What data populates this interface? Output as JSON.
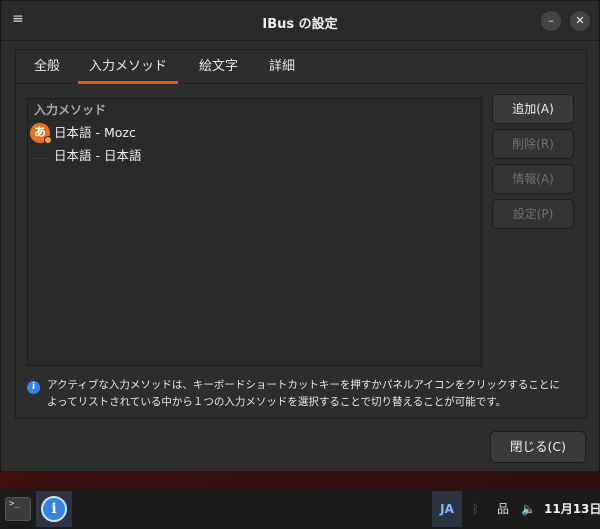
{
  "window": {
    "title": "IBus の設定",
    "menu_icon": "≡",
    "minimize_icon": "–",
    "close_icon": "✕"
  },
  "tabs": [
    {
      "label": "全般"
    },
    {
      "label": "入力メソッド",
      "active": true
    },
    {
      "label": "絵文字"
    },
    {
      "label": "詳細"
    }
  ],
  "input_methods": {
    "header": "入力メソッド",
    "items": [
      {
        "label": "日本語 - Mozc",
        "icon": "あ"
      },
      {
        "label": "日本語 - 日本語",
        "icon": ""
      }
    ]
  },
  "buttons": {
    "add": "追加(A)",
    "remove": "削除(R)",
    "about": "情報(A)",
    "preferences": "設定(P)",
    "close": "閉じる(C)"
  },
  "info": {
    "icon": "i",
    "text_line1": "アクティブな入力メソッドは、キーボードショートカットキーを押すかパネルアイコンをクリックすることに",
    "text_line2": "よってリストされている中から１つの入力メソッドを選択することで切り替えることが可能です。"
  },
  "taskbar": {
    "terminal_glyph": ">_",
    "info_glyph": "i",
    "ime_indicator": "JA",
    "bluetooth_icon": "ᛒ",
    "network_icon": "品",
    "volume_icon": "🔈",
    "clock": "11月13日"
  }
}
